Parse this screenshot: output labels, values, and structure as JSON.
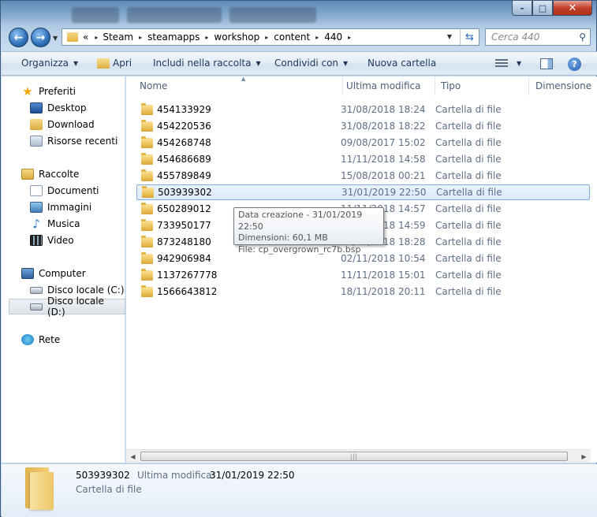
{
  "titlebar": {
    "minimize_glyph": "–",
    "maximize_glyph": "□",
    "close_glyph": "✕"
  },
  "address": {
    "overflow": "«",
    "crumbs": [
      "Steam",
      "steamapps",
      "workshop",
      "content",
      "440"
    ],
    "separator": "▸",
    "search_placeholder": "Cerca 440"
  },
  "toolbar": {
    "organize": "Organizza",
    "open": "Apri",
    "include": "Includi nella raccolta",
    "share": "Condividi con",
    "new_folder": "Nuova cartella",
    "help": "?"
  },
  "nav": {
    "favorites": "Preferiti",
    "desktop": "Desktop",
    "download": "Download",
    "recent": "Risorse recenti",
    "libraries": "Raccolte",
    "documents": "Documenti",
    "pictures": "Immagini",
    "music": "Musica",
    "video": "Video",
    "computer": "Computer",
    "disk_c": "Disco locale (C:)",
    "disk_d": "Disco locale (D:)",
    "network": "Rete"
  },
  "columns": {
    "name": "Nome",
    "modified": "Ultima modifica",
    "type": "Tipo",
    "size": "Dimensione"
  },
  "files": [
    {
      "name": "454133929",
      "date": "31/08/2018 18:24",
      "type": "Cartella di file"
    },
    {
      "name": "454220536",
      "date": "31/08/2018 18:22",
      "type": "Cartella di file"
    },
    {
      "name": "454268748",
      "date": "09/08/2017 15:02",
      "type": "Cartella di file"
    },
    {
      "name": "454686689",
      "date": "11/11/2018 14:58",
      "type": "Cartella di file"
    },
    {
      "name": "455789849",
      "date": "15/08/2018 00:21",
      "type": "Cartella di file"
    },
    {
      "name": "503939302",
      "date": "31/01/2019 22:50",
      "type": "Cartella di file"
    },
    {
      "name": "650289012",
      "date": "11/11/2018 14:57",
      "type": "Cartella di file"
    },
    {
      "name": "733950177",
      "date": "11/11/2018 14:59",
      "type": "Cartella di file"
    },
    {
      "name": "873248180",
      "date": "31/08/2018 18:28",
      "type": "Cartella di file"
    },
    {
      "name": "942906984",
      "date": "02/11/2018 10:54",
      "type": "Cartella di file"
    },
    {
      "name": "1137267778",
      "date": "11/11/2018 15:01",
      "type": "Cartella di file"
    },
    {
      "name": "1566643812",
      "date": "18/11/2018 20:11",
      "type": "Cartella di file"
    }
  ],
  "selected_index": 5,
  "tooltip": {
    "line1": "Data creazione - 31/01/2019 22:50",
    "line2": "Dimensioni: 60,1 MB",
    "line3": "File: cp_overgrown_rc7b.bsp"
  },
  "details": {
    "name": "503939302",
    "modified_label": "Ultima modifica:",
    "modified_value": "31/01/2019 22:50",
    "type": "Cartella di file"
  },
  "colors": {
    "accent": "#2c6fb6",
    "selection": "#d9eafc",
    "toolbar_text": "#1e395b"
  }
}
